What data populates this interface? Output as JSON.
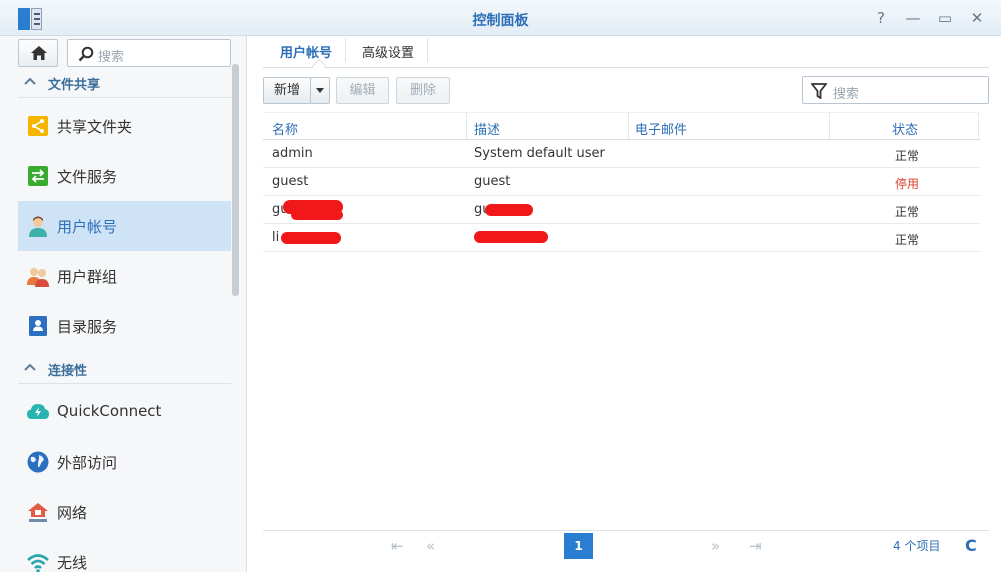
{
  "window": {
    "title": "控制面板",
    "controls": {
      "help": "?",
      "minimize": "—",
      "maximize": "▭",
      "close": "✕"
    }
  },
  "sidebar": {
    "search_placeholder": "搜索",
    "sections": [
      {
        "label": "文件共享",
        "items": [
          {
            "label": "共享文件夹",
            "icon": "share-folder-icon"
          },
          {
            "label": "文件服务",
            "icon": "file-services-icon"
          },
          {
            "label": "用户帐号",
            "icon": "user-icon",
            "active": true
          },
          {
            "label": "用户群组",
            "icon": "group-icon"
          },
          {
            "label": "目录服务",
            "icon": "directory-icon"
          }
        ]
      },
      {
        "label": "连接性",
        "items": [
          {
            "label": "QuickConnect",
            "icon": "quickconnect-icon"
          },
          {
            "label": "外部访问",
            "icon": "globe-icon"
          },
          {
            "label": "网络",
            "icon": "network-icon"
          },
          {
            "label": "无线",
            "icon": "wifi-icon"
          }
        ]
      }
    ]
  },
  "main": {
    "tabs": [
      {
        "label": "用户帐号",
        "active": true
      },
      {
        "label": "高级设置"
      }
    ],
    "toolbar": {
      "create": "新增",
      "edit": "编辑",
      "delete": "删除",
      "filter_placeholder": "搜索"
    },
    "columns": {
      "name": "名称",
      "description": "描述",
      "email": "电子邮件",
      "status": "状态"
    },
    "rows": [
      {
        "name": "admin",
        "description": "System default user",
        "email": "",
        "status": "正常",
        "status_color": "#333333"
      },
      {
        "name": "guest",
        "description": "guest",
        "email": "",
        "status": "停用",
        "status_color": "#d9402b"
      },
      {
        "name": "gu",
        "description": "gu",
        "email": "",
        "status": "正常",
        "status_color": "#333333",
        "redacted": true
      },
      {
        "name": "li",
        "description": "",
        "email": "",
        "status": "正常",
        "status_color": "#333333",
        "redacted": true
      }
    ],
    "pager": {
      "current_page": "1",
      "count_text": "4 个项目",
      "refresh": "C"
    }
  },
  "colors": {
    "accent": "#2a7ed2",
    "active_nav": "#cfe3f7",
    "disabled_status": "#d9402b"
  }
}
